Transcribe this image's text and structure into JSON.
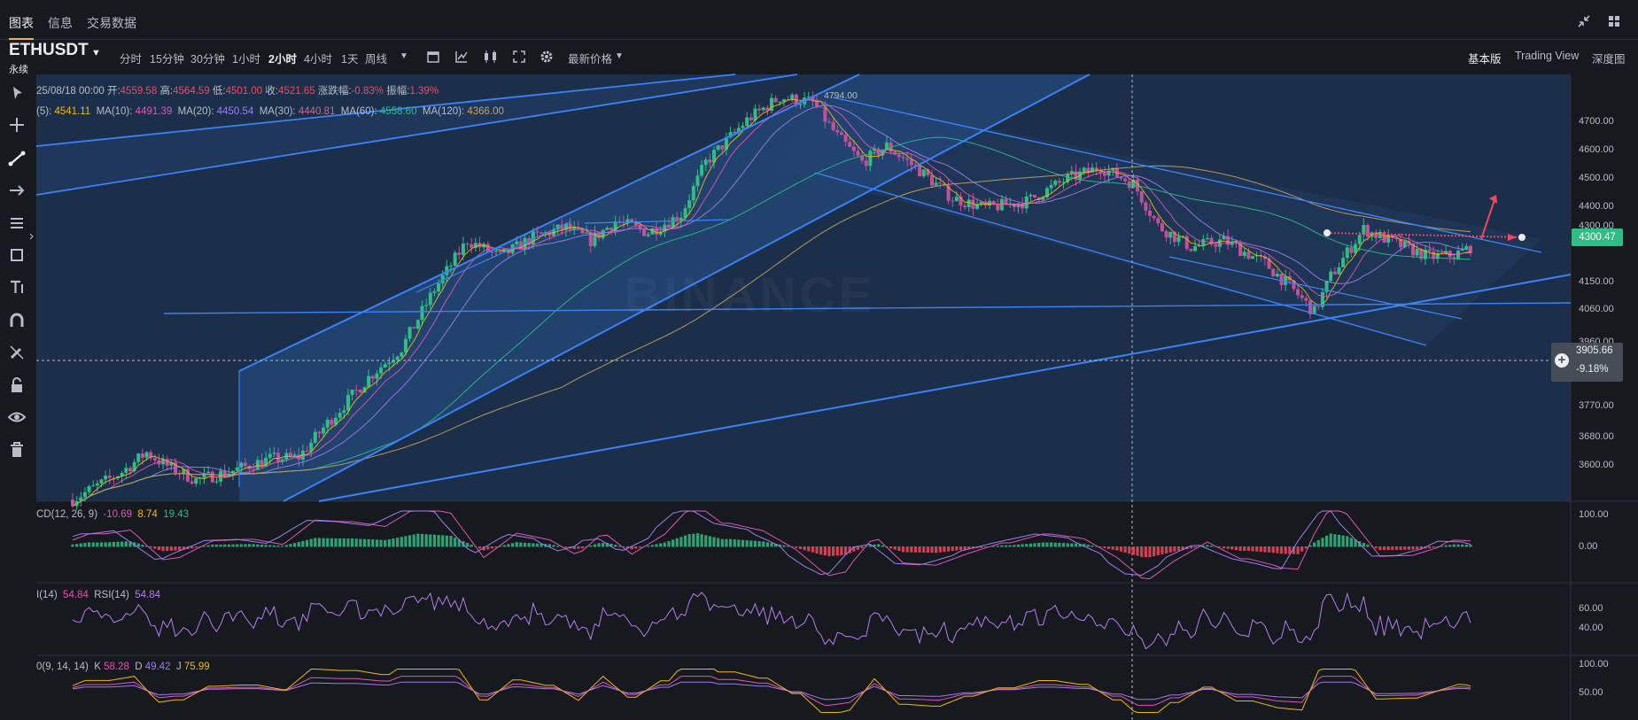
{
  "tabs": [
    {
      "label": "图表"
    },
    {
      "label": "信息"
    },
    {
      "label": "交易数据"
    }
  ],
  "symbol": {
    "name": "ETHUSDT",
    "sub": "永续"
  },
  "timeframes": [
    "分时",
    "15分钟",
    "30分钟",
    "1小时",
    "2小时",
    "4小时",
    "1天",
    "周线"
  ],
  "active_timeframe": "2小时",
  "latest_price_label": "最新价格",
  "views": [
    "基本版",
    "Trading View",
    "深度图"
  ],
  "active_view": "基本版",
  "ohlc": {
    "date": "25/08/18 00:00",
    "open_label": "开:",
    "open": "4559.58",
    "high_label": "高:",
    "high": "4564.59",
    "low_label": "低:",
    "low": "4501.00",
    "close_label": "收:",
    "close": "4521.65",
    "chg_label": "涨跌幅:",
    "chg": "-0.83%",
    "amp_label": "振幅:",
    "amp": "1.39%"
  },
  "ma": {
    "ma5_label": "(5):",
    "ma5": "4541.11",
    "ma10_label": "MA(10):",
    "ma10": "4491.39",
    "ma20_label": "MA(20):",
    "ma20": "4450.54",
    "ma30_label": "MA(30):",
    "ma30": "4440.81",
    "ma60_label": "MA(60):",
    "ma60": "4558.60",
    "ma120_label": "MA(120):",
    "ma120": "4366.00"
  },
  "macd": {
    "label": "CD(12, 26, 9)",
    "dif": "-10.69",
    "dea": "8.74",
    "hist": "19.43"
  },
  "rsi": {
    "label1": "I(14)",
    "v1": "54.84",
    "label2": "RSI(14)",
    "v2": "54.84"
  },
  "kdj": {
    "label": "0(9, 14, 14)",
    "k_label": "K",
    "k": "58.28",
    "d_label": "D",
    "d": "49.42",
    "j_label": "J",
    "j": "75.99"
  },
  "price_axis": [
    "4700.00",
    "4600.00",
    "4500.00",
    "4400.00",
    "4300.00",
    "4150.00",
    "4060.00",
    "3960.00",
    "3770.00",
    "3680.00",
    "3600.00"
  ],
  "macd_axis": [
    "100.00",
    "0.00"
  ],
  "rsi_axis": [
    "60.00",
    "40.00"
  ],
  "kdj_axis": [
    "100.00",
    "50.00"
  ],
  "current_price": "4300.47",
  "crosshair": {
    "price": "3905.66",
    "change": "-9.18%"
  },
  "high_marker": "4794.00",
  "watermark": "BINANCE",
  "colors": {
    "up": "#2ebd85",
    "down": "#f6465d",
    "accent": "#f0b90b",
    "bg": "#161a1e",
    "channel": "#2c6fd6",
    "ma5": "#f0b90b",
    "ma10": "#e055b8",
    "ma20": "#9c7df0",
    "ma60": "#2ebd85",
    "ma120": "#c9a35a"
  },
  "chart_data": {
    "type": "candlestick",
    "interval": "2小时",
    "ylim": [
      3520,
      4830
    ],
    "anchors": [
      [
        0,
        3525
      ],
      [
        12,
        3610
      ],
      [
        18,
        3670
      ],
      [
        22,
        3635
      ],
      [
        30,
        3585
      ],
      [
        38,
        3610
      ],
      [
        48,
        3650
      ],
      [
        55,
        3655
      ],
      [
        62,
        3760
      ],
      [
        72,
        3900
      ],
      [
        80,
        3990
      ],
      [
        88,
        4170
      ],
      [
        96,
        4320
      ],
      [
        104,
        4270
      ],
      [
        112,
        4330
      ],
      [
        120,
        4360
      ],
      [
        126,
        4320
      ],
      [
        132,
        4380
      ],
      [
        140,
        4345
      ],
      [
        148,
        4400
      ],
      [
        154,
        4560
      ],
      [
        164,
        4690
      ],
      [
        172,
        4760
      ],
      [
        180,
        4745
      ],
      [
        186,
        4640
      ],
      [
        192,
        4560
      ],
      [
        198,
        4610
      ],
      [
        206,
        4535
      ],
      [
        214,
        4450
      ],
      [
        222,
        4420
      ],
      [
        232,
        4440
      ],
      [
        242,
        4510
      ],
      [
        250,
        4545
      ],
      [
        258,
        4495
      ],
      [
        264,
        4365
      ],
      [
        272,
        4300
      ],
      [
        280,
        4320
      ],
      [
        290,
        4250
      ],
      [
        296,
        4180
      ],
      [
        302,
        4100
      ],
      [
        306,
        4210
      ],
      [
        314,
        4355
      ],
      [
        322,
        4310
      ],
      [
        330,
        4270
      ],
      [
        336,
        4275
      ],
      [
        340,
        4300
      ]
    ]
  }
}
